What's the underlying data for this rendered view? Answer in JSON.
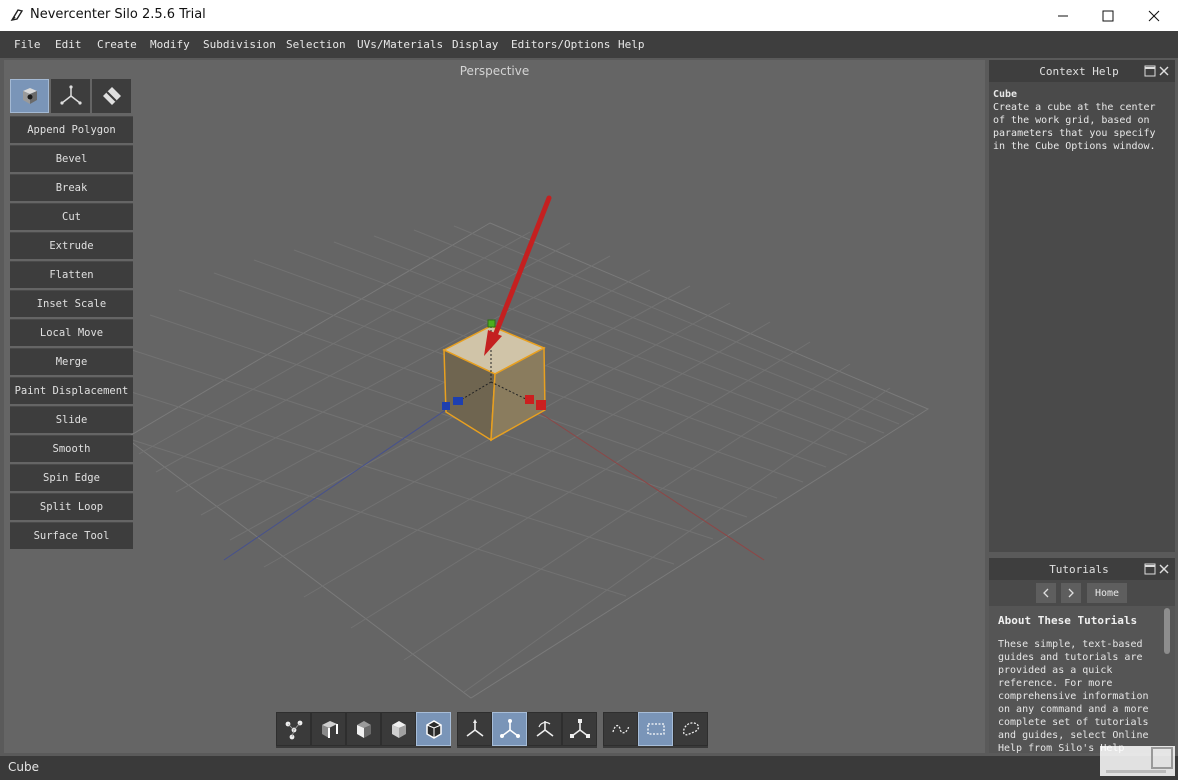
{
  "window": {
    "title": "Nevercenter Silo 2.5.6 Trial"
  },
  "menubar": {
    "items": [
      "File",
      "Edit",
      "Create",
      "Modify",
      "Subdivision",
      "Selection",
      "UVs/Materials",
      "Display",
      "Editors/Options",
      "Help"
    ]
  },
  "viewport": {
    "label": "Perspective"
  },
  "tool_panel": {
    "mode_tabs": [
      "cube-mode-icon",
      "axis-mode-icon",
      "diamond-mode-icon"
    ],
    "active_tab": 0,
    "tools": [
      "Append Polygon",
      "Bevel",
      "Break",
      "Cut",
      "Extrude",
      "Flatten",
      "Inset Scale",
      "Local Move",
      "Merge",
      "Paint Displacement",
      "Slide",
      "Smooth",
      "Spin Edge",
      "Split Loop",
      "Surface Tool"
    ]
  },
  "context_help": {
    "title": "Context Help",
    "topic": "Cube",
    "text": "Create a cube at the center of the work grid, based on parameters that you specify in the Cube Options window."
  },
  "tutorials": {
    "title": "Tutorials",
    "home_label": "Home",
    "heading": "About These Tutorials",
    "text": "These simple, text-based guides and tutorials are provided as a quick reference. For more comprehensive information on any command and a more complete set of tutorials and guides, select Online Help from Silo's Help"
  },
  "bottom_toolbar": {
    "selection_modes": [
      "vertex-select-icon",
      "edge-select-icon",
      "face-select-icon",
      "object-select-icon",
      "cube-select-icon"
    ],
    "active_selection_mode": 4,
    "manipulators": [
      "move-manipulator-icon",
      "universal-manipulator-icon",
      "rotate-manipulator-icon",
      "scale-manipulator-icon"
    ],
    "active_manipulator": 1,
    "select_shapes": [
      "lasso-select-icon",
      "rect-select-icon",
      "paint-select-icon"
    ],
    "active_select_shape": 1
  },
  "status": {
    "text": "Cube"
  },
  "colors": {
    "accent_blue": "#7a95b8",
    "selection_orange": "#e8a020",
    "axis_red": "#cc1f1f",
    "axis_blue": "#1d3fb0",
    "axis_green": "#4cae1e"
  }
}
